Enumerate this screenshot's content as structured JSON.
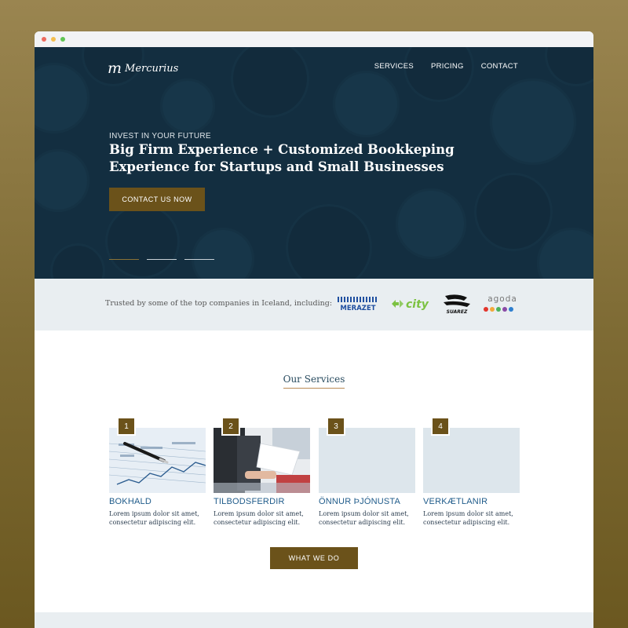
{
  "brand": {
    "logo_mark": "m",
    "logo_text": "Mercurius"
  },
  "nav": [
    {
      "label": "SERVICES"
    },
    {
      "label": "PRICING"
    },
    {
      "label": "CONTACT"
    }
  ],
  "hero": {
    "eyebrow": "INVEST IN YOUR FUTURE",
    "headline": "Big Firm Experience + Customized Bookkeping Experience for Startups and Small Businesses",
    "cta_label": "CONTACT US NOW",
    "slides": 3,
    "active_slide": 1
  },
  "trusted": {
    "text": "Trusted by some of the top companies in Iceland, including:",
    "logos": [
      {
        "name": "MERAZET",
        "icon": "merazet-logo",
        "color": "#1f4fa0"
      },
      {
        "name": "city",
        "icon": "city-logo",
        "color": "#7cc242"
      },
      {
        "name": "SUAREZ",
        "icon": "suarez-logo",
        "color": "#111111"
      },
      {
        "name": "agoda",
        "icon": "agoda-logo",
        "color": "#666666"
      }
    ]
  },
  "services": {
    "title": "Our Services",
    "items": [
      {
        "num": "1",
        "title": "BOKHALD",
        "desc": "Lorem ipsum dolor sit amet, consectetur adipiscing elit.",
        "image": "financial-chart-pen"
      },
      {
        "num": "2",
        "title": "TILBODSFERDIR",
        "desc": "Lorem ipsum dolor sit amet, consectetur adipiscing elit.",
        "image": "business-meeting"
      },
      {
        "num": "3",
        "title": "ÖNNUR ÞJÓNUSTA",
        "desc": "Lorem ipsum dolor sit amet, consectetur adipiscing elit.",
        "image": "placeholder"
      },
      {
        "num": "4",
        "title": "VERKÆTLANIR",
        "desc": "Lorem ipsum dolor sit amet, consectetur adipiscing elit.",
        "image": "placeholder"
      }
    ],
    "button_label": "WHAT WE DO"
  },
  "colors": {
    "accent": "#6b521a",
    "hero_bg": "#163446",
    "link_blue": "#1f5b8a",
    "band": "#e9eef1"
  }
}
